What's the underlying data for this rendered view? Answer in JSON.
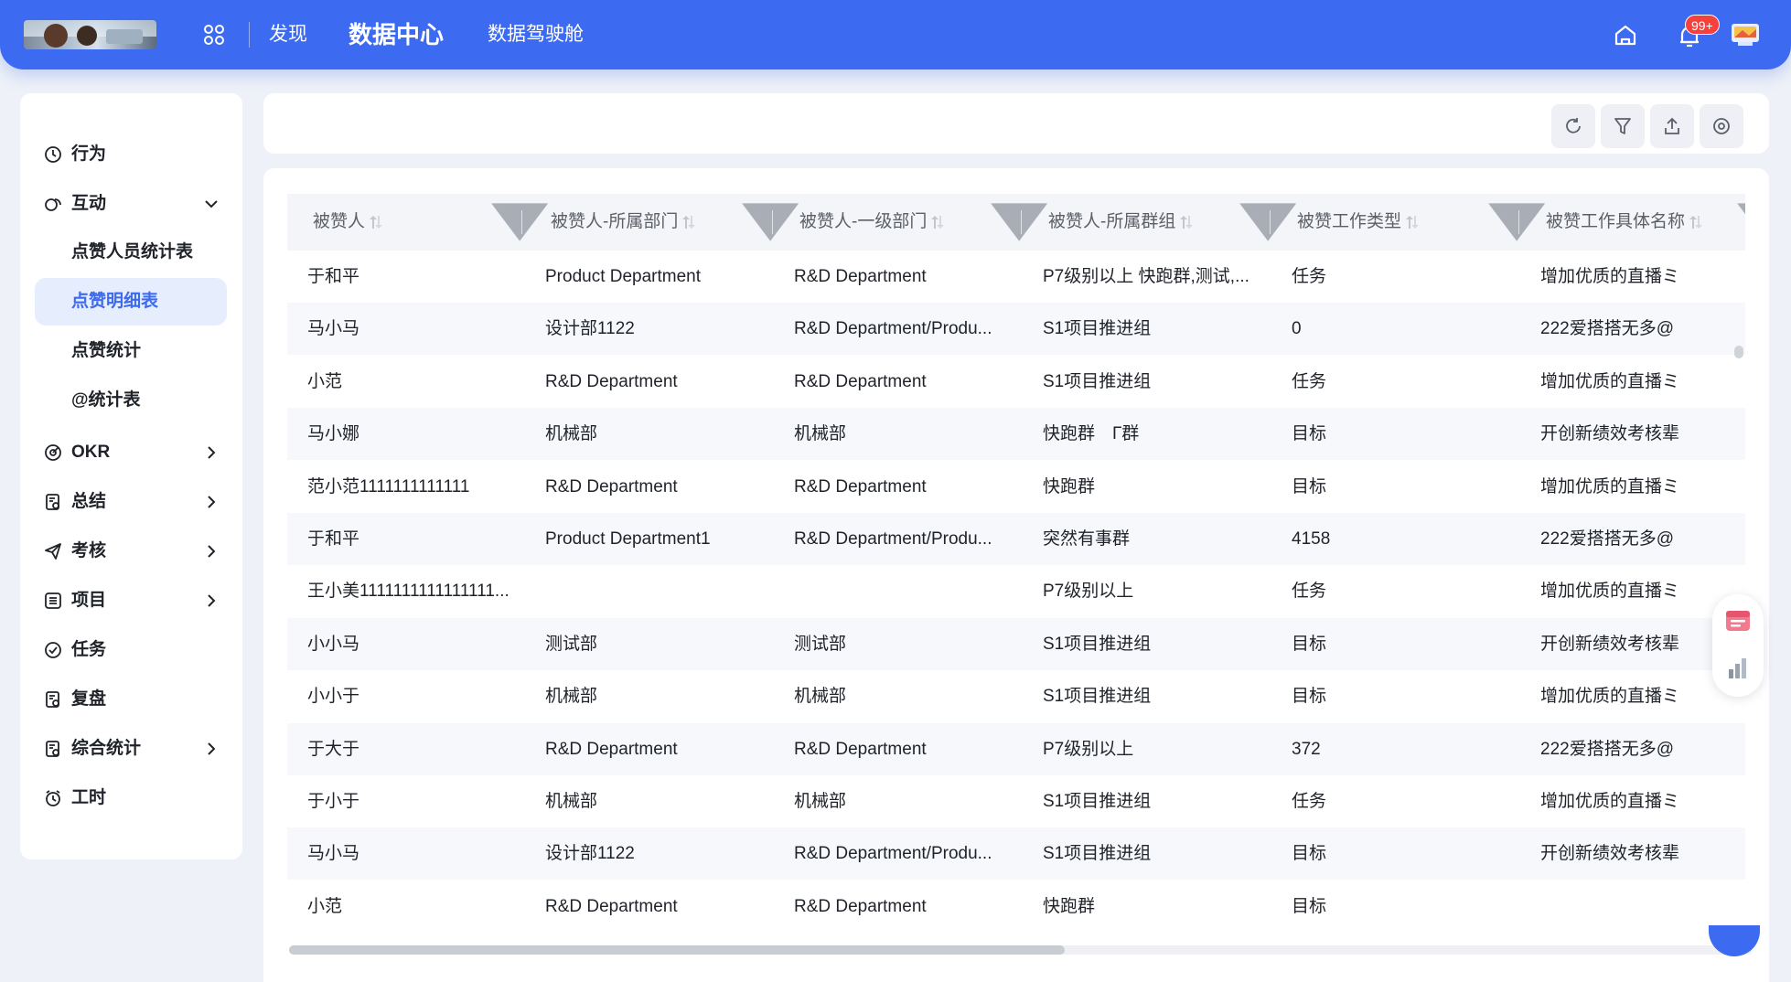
{
  "topbar": {
    "nav": [
      "发现",
      "数据中心",
      "数据驾驶舱"
    ],
    "active_nav": "数据中心",
    "notification_badge": "99+",
    "brand_color": "#3c6af1"
  },
  "sidebar": {
    "items": [
      {
        "label": "行为",
        "icon": "behavior-icon"
      },
      {
        "label": "互动",
        "icon": "interaction-icon",
        "expanded": true
      },
      {
        "label": "点赞人员统计表",
        "sub": true
      },
      {
        "label": "点赞明细表",
        "sub": true,
        "active": true
      },
      {
        "label": "点赞统计",
        "sub": true
      },
      {
        "label": "@统计表",
        "sub": true
      },
      {
        "label": "OKR",
        "icon": "okr-icon"
      },
      {
        "label": "总结",
        "icon": "summary-icon"
      },
      {
        "label": "考核",
        "icon": "assessment-icon"
      },
      {
        "label": "项目",
        "icon": "project-icon"
      },
      {
        "label": "任务",
        "icon": "task-icon"
      },
      {
        "label": "复盘",
        "icon": "review-icon"
      },
      {
        "label": "综合统计",
        "icon": "stats-icon"
      },
      {
        "label": "工时",
        "icon": "clock-icon"
      }
    ]
  },
  "toolbar": {
    "buttons": [
      "refresh-icon",
      "filter-icon",
      "export-icon",
      "settings-icon"
    ]
  },
  "table": {
    "columns": [
      "被赞人",
      "被赞人-所属部门",
      "被赞人-一级部门",
      "被赞人-所属群组",
      "被赞工作类型",
      "被赞工作具体名称"
    ],
    "rows": [
      [
        "于和平",
        "Product Department",
        "R&D Department",
        "P7级别以上 快跑群,测试,...",
        "任务",
        "增加优质的直播ミ"
      ],
      [
        "马小马",
        "设计部1122",
        "R&D Department/Produ...",
        "S1项目推进组",
        "0",
        "222爱搭搭无多@"
      ],
      [
        "小范",
        "R&D Department",
        "R&D Department",
        "S1项目推进组",
        "任务",
        "增加优质的直播ミ"
      ],
      [
        "马小娜",
        "机械部",
        "机械部",
        "快跑群　Г群",
        "目标",
        "开创新绩效考核辈"
      ],
      [
        "范小范1111111111111",
        "R&D Department",
        "R&D Department",
        "快跑群",
        "目标",
        "增加优质的直播ミ"
      ],
      [
        "于和平",
        "Product Department1",
        "R&D Department/Produ...",
        "突然有事群",
        "4158",
        "222爱搭搭无多@"
      ],
      [
        "王小美1111111111111111...",
        "",
        "",
        "P7级别以上",
        "任务",
        "增加优质的直播ミ"
      ],
      [
        "小小马",
        "测试部",
        "测试部",
        "S1项目推进组",
        "目标",
        "开创新绩效考核辈"
      ],
      [
        "小小于",
        "机械部",
        "机械部",
        "S1项目推进组",
        "目标",
        "增加优质的直播ミ"
      ],
      [
        "于大于",
        "R&D Department",
        "R&D Department",
        "P7级别以上",
        "372",
        "222爱搭搭无多@"
      ],
      [
        "于小于",
        "机械部",
        "机械部",
        "S1项目推进组",
        "任务",
        "增加优质的直播ミ"
      ],
      [
        "马小马",
        "设计部1122",
        "R&D Department/Produ...",
        "S1项目推进组",
        "目标",
        "开创新绩效考核辈"
      ],
      [
        "小范",
        "R&D Department",
        "R&D Department",
        "快跑群",
        "目标",
        ""
      ]
    ]
  }
}
